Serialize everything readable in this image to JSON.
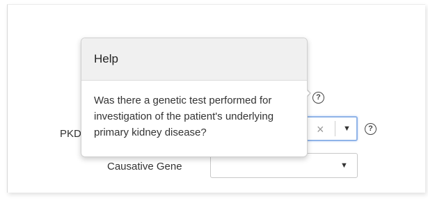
{
  "form": {
    "pkd_label": "PKD",
    "causative_gene_label": "Causative Gene",
    "genetic_test_select": {
      "clear_icon": "×",
      "caret_icon": "▼"
    },
    "causative_gene_select": {
      "caret_icon": "▼"
    },
    "help_icon_glyph": "?"
  },
  "popover": {
    "title": "Help",
    "body": "Was there a genetic test performed for investigation of the patient's underlying primary kidney disease?"
  },
  "colors": {
    "focus_border": "#8fb3e8",
    "popover_header": "#f0f0f0"
  }
}
